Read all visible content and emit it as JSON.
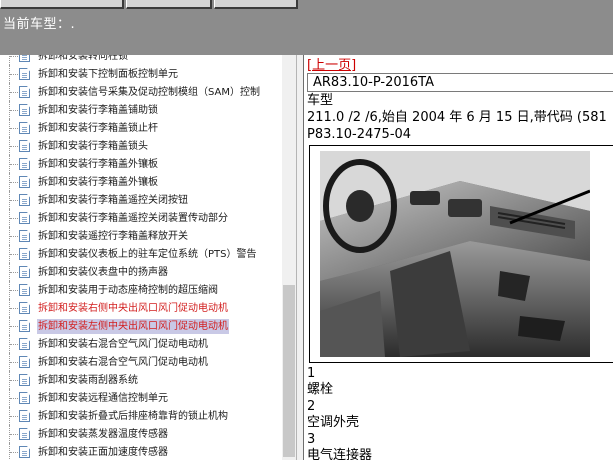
{
  "header": {
    "current_model_label": "当前车型：."
  },
  "tree": {
    "items": [
      {
        "label": "拆卸和安装转向柱锁",
        "style": "normal"
      },
      {
        "label": "拆卸和安装下控制面板控制单元",
        "style": "normal"
      },
      {
        "label": "拆卸和安装信号采集及促动控制模组（SAM）控制",
        "style": "normal"
      },
      {
        "label": "拆卸和安装行李箱盖铺助锁",
        "style": "normal"
      },
      {
        "label": "拆卸和安装行李箱盖锁止杆",
        "style": "normal"
      },
      {
        "label": "拆卸和安装行李箱盖锁头",
        "style": "normal"
      },
      {
        "label": "拆卸和安装行李箱盖外镶板",
        "style": "normal"
      },
      {
        "label": "拆卸和安装行李箱盖外镶板",
        "style": "normal"
      },
      {
        "label": "拆卸和安装行李箱盖遥控关闭按钮",
        "style": "normal"
      },
      {
        "label": "拆卸和安装行李箱盖遥控关闭装置传动部分",
        "style": "normal"
      },
      {
        "label": "拆卸和安装遥控行李箱盖释放开关",
        "style": "normal"
      },
      {
        "label": "拆卸和安装仪表板上的驻车定位系统（PTS）警告",
        "style": "normal"
      },
      {
        "label": "拆卸和安装仪表盘中的扬声器",
        "style": "normal"
      },
      {
        "label": "拆卸和安装用于动态座椅控制的超压缩阀",
        "style": "normal"
      },
      {
        "label": "拆卸和安装右侧中央出风口风门促动电动机",
        "style": "red"
      },
      {
        "label": "拆卸和安装左侧中央出风口风门促动电动机",
        "style": "red-selected"
      },
      {
        "label": "拆卸和安装右混合空气风门促动电动机",
        "style": "normal"
      },
      {
        "label": "拆卸和安装右混合空气风门促动电动机",
        "style": "normal"
      },
      {
        "label": "拆卸和安装雨刮器系统",
        "style": "normal"
      },
      {
        "label": "拆卸和安装远程通信控制单元",
        "style": "normal"
      },
      {
        "label": "拆卸和安装折叠式后排座椅靠背的锁止机构",
        "style": "normal"
      },
      {
        "label": "拆卸和安装蒸发器温度传感器",
        "style": "normal"
      },
      {
        "label": "拆卸和安装正面加速度传感器",
        "style": "normal"
      }
    ]
  },
  "content": {
    "prev_page": "[上一页]",
    "doc_id": "AR83.10-P-2016TA",
    "model_heading": "车型",
    "model_text": "211.0 /2 /6,始自 2004 年 6 月 15 日,带代码 (581",
    "part_number": "P83.10-2475-04",
    "legend": [
      {
        "num": "1",
        "label": "螺栓"
      },
      {
        "num": "2",
        "label": "空调外壳"
      },
      {
        "num": "3",
        "label": "电气连接器"
      }
    ]
  },
  "colors": {
    "header_bg": "#8c8c8c",
    "link_red": "#cc0000",
    "tree_red": "#d21e1e",
    "selection": "#c9c9e6"
  }
}
